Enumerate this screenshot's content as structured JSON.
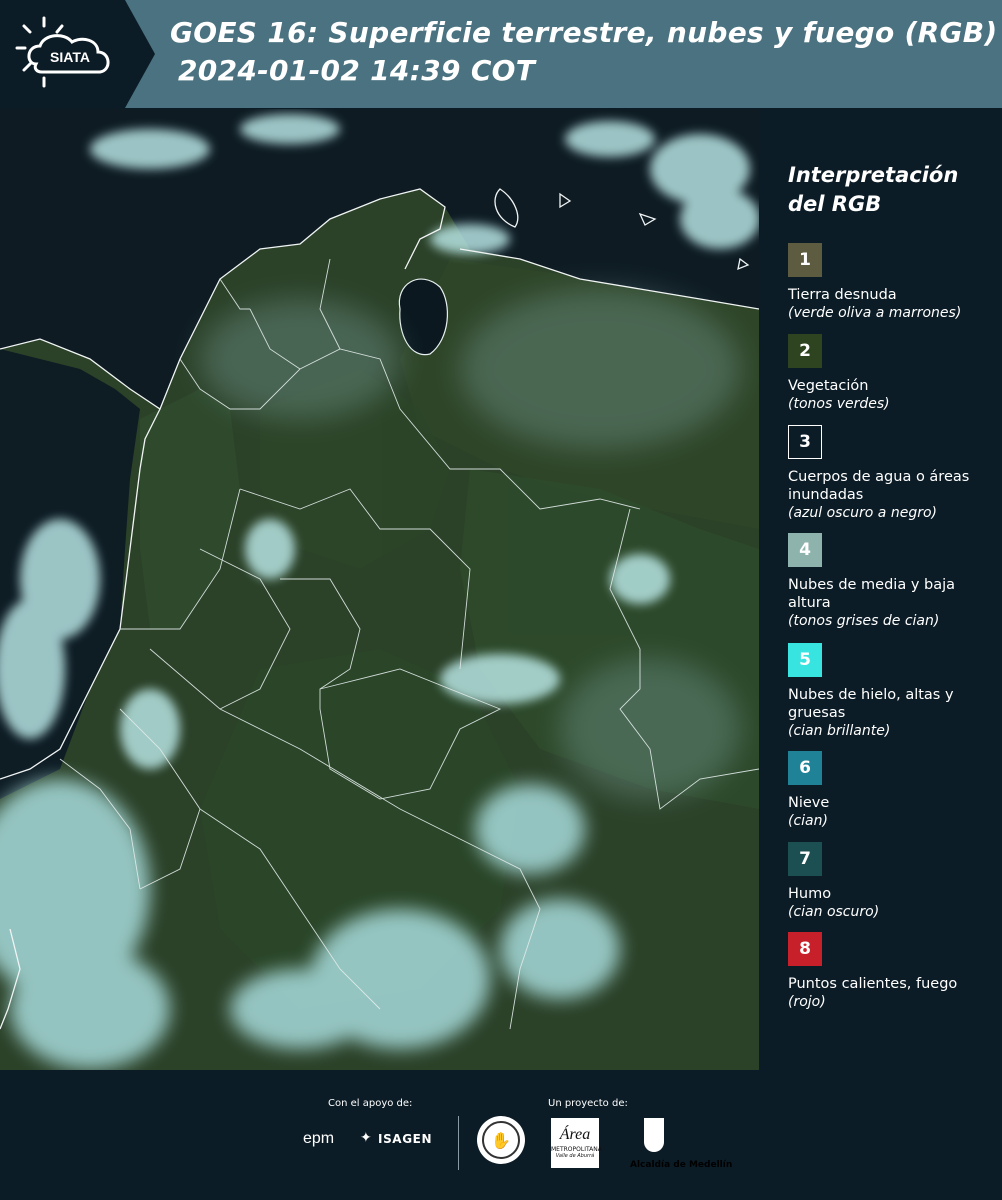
{
  "header": {
    "logo_text": "SIATA",
    "title_line1": "GOES 16: Superficie terrestre, nubes y fuego (RGB)",
    "title_line2": "2024-01-02 14:39 COT"
  },
  "legend": {
    "title_line1": "Interpretación",
    "title_line2": "del RGB",
    "items": [
      {
        "num": "1",
        "label": "Tierra desnuda",
        "sub": "(verde oliva a marrones)",
        "color": "#5e5c40"
      },
      {
        "num": "2",
        "label": "Vegetación",
        "sub": "(tonos verdes)",
        "color": "#2e4320"
      },
      {
        "num": "3",
        "label": "Cuerpos de agua o áreas inundadas",
        "sub": "(azul oscuro a negro)",
        "color": "#0c1c26"
      },
      {
        "num": "4",
        "label": "Nubes de media y baja altura",
        "sub": "(tonos grises de cian)",
        "color": "#8eb3ad"
      },
      {
        "num": "5",
        "label": "Nubes de hielo, altas y gruesas",
        "sub": "(cian brillante)",
        "color": "#38e4e0"
      },
      {
        "num": "6",
        "label": "Nieve",
        "sub": "(cian)",
        "color": "#1f8296"
      },
      {
        "num": "7",
        "label": "Humo",
        "sub": "(cian oscuro)",
        "color": "#1c4f52"
      },
      {
        "num": "8",
        "label": "Puntos calientes, fuego",
        "sub": "(rojo)",
        "color": "#c8202a"
      }
    ]
  },
  "footer": {
    "support_label": "Con el apoyo de:",
    "project_label": "Un proyecto de:",
    "logo_epm": "epm",
    "logo_isagen": "ISAGEN",
    "logo_area": "Área",
    "logo_area_sub": "METROPOLITANA",
    "logo_area_sub2": "Valle de Aburrá",
    "logo_alcaldia": "Alcaldía de Medellín"
  },
  "colors": {
    "header_bg": "#4a7280",
    "page_bg": "#0c1c26",
    "vegetation": "#2f4a2c",
    "cloud": "#a8dede"
  }
}
